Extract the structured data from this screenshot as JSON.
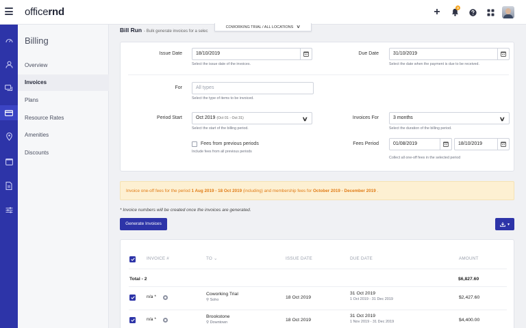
{
  "app": {
    "logo_prefix": "office",
    "logo_suffix": "rnd"
  },
  "topbar": {
    "notifications_count": "3"
  },
  "billing_nav": {
    "title": "Billing",
    "items": [
      {
        "label": "Overview",
        "active": false
      },
      {
        "label": "Invoices",
        "active": true
      },
      {
        "label": "Plans",
        "active": false
      },
      {
        "label": "Resource Rates",
        "active": false
      },
      {
        "label": "Amenities",
        "active": false
      },
      {
        "label": "Discounts",
        "active": false
      }
    ]
  },
  "page": {
    "title": "Bill Run",
    "subtitle": "- Bulk generate invoices for a selec",
    "location_selector": "COWORKING TRIAL  /  ALL LOCATIONS"
  },
  "form": {
    "issue_date": {
      "label": "Issue Date",
      "value": "18/10/2019",
      "hint": "Select the issue date of the invoices."
    },
    "due_date": {
      "label": "Due Date",
      "value": "31/10/2019",
      "hint": "Select the date when the payment is due to be received."
    },
    "for": {
      "label": "For",
      "placeholder": "All types",
      "hint": "Select the type of items to be invoiced."
    },
    "period_start": {
      "label": "Period Start",
      "value": "Oct 2019",
      "value_detail": "(Oct 01 - Oct 31)",
      "hint": "Select the start of the billing period."
    },
    "invoices_for": {
      "label": "Invoices For",
      "value": "3 months",
      "hint": "Select the duration of the billing period."
    },
    "fees_prev": {
      "label": "Fees from previous periods",
      "hint": "Include fees from all previous periods"
    },
    "fees_period": {
      "label": "Fees Period",
      "from": "01/08/2019",
      "to": "18/10/2019",
      "hint": "Collect all one-off fees in the selected period"
    }
  },
  "notice": {
    "part1": "Invoice one-off fees for the period ",
    "period": "1 Aug 2019 - 18 Oct 2019",
    "part2": " (including) and membership fees for ",
    "months": "October 2019 - December 2019",
    "part3": " ."
  },
  "note": "* Invoice numbers will be created once the invoices are generated.",
  "actions": {
    "generate_label": "Generate Invoices"
  },
  "table": {
    "headers": {
      "invoice": "INVOICE #",
      "to": "TO",
      "issue_date": "ISSUE DATE",
      "due_date": "DUE DATE",
      "amount": "AMOUNT"
    },
    "total_label": "Total - 2",
    "total_amount": "$6,827.60",
    "rows": [
      {
        "invoice": "n/a *",
        "to": "Coworking Trial",
        "location": "Soho",
        "issue_date": "18 Oct 2019",
        "due_date": "31 Oct 2019",
        "period": "1 Oct 2019 - 31 Dec 2019",
        "amount": "$2,427.60"
      },
      {
        "invoice": "n/a *",
        "to": "Brookstone",
        "location": "Downtown",
        "issue_date": "18 Oct 2019",
        "due_date": "31 Oct 2019",
        "period": "1 Nov 2019 - 31 Dec 2019",
        "amount": "$4,400.00"
      }
    ]
  },
  "colors": {
    "primary": "#2d34a8",
    "notice_bg": "#fdf0d2",
    "notice_text": "#e07b16"
  }
}
